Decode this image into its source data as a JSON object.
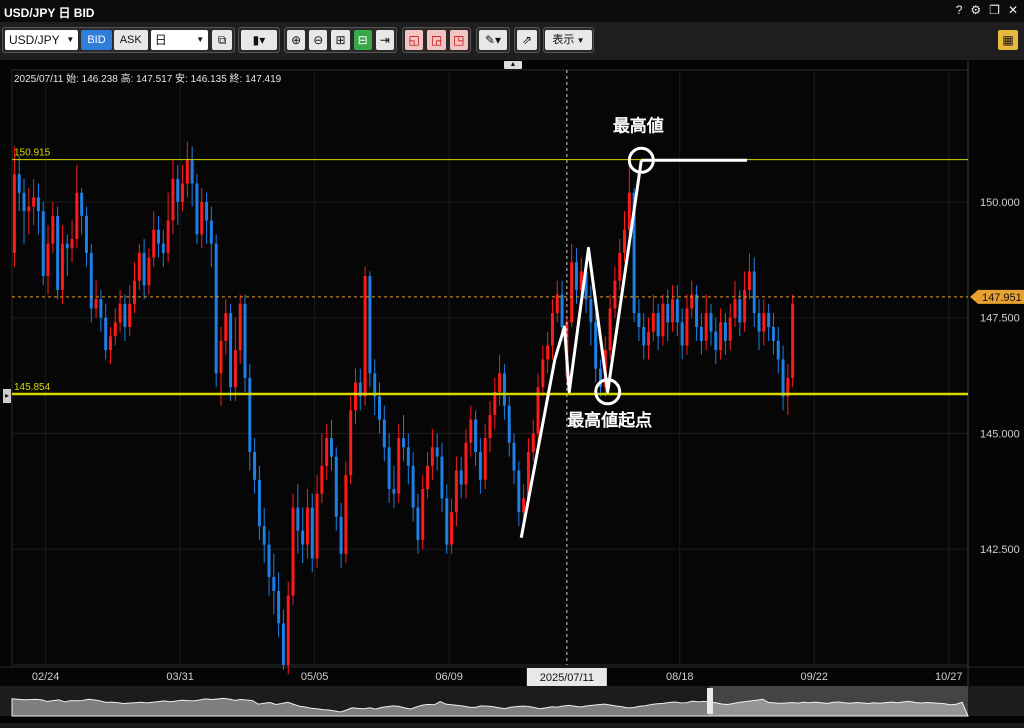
{
  "window": {
    "title": "USD/JPY 日 BID",
    "help_icon": "?",
    "controls": [
      "help-icon",
      "settings-gear-icon",
      "restore-window-icon",
      "close-icon"
    ]
  },
  "toolbar": {
    "symbol": "USD/JPY",
    "bid_label": "BID",
    "ask_label": "ASK",
    "period": "日",
    "display_label": "表示",
    "icons": [
      "compare-icon",
      "candle-type-icon",
      "zoom-in-icon",
      "zoom-out-icon",
      "fit-width-icon",
      "fit-height-icon",
      "scroll-right-icon",
      "draw-box-add-icon",
      "draw-box-copy-icon",
      "draw-box-delete-icon",
      "pen-icon",
      "export-icon",
      "layout-icon"
    ]
  },
  "info_bar": "2025/07/11  始: 146.238  高: 147.517  安: 146.135  終: 147.419",
  "colors": {
    "up": "#ff1a1a",
    "down": "#1e7fe6",
    "level_line": "#d8d800",
    "current_price": "#e8a030",
    "annotation": "#ffffff"
  },
  "chart_data": {
    "type": "candlestick",
    "y_ticks": [
      "150.000",
      "147.500",
      "145.000",
      "142.500"
    ],
    "y_tick_values": [
      150.0,
      147.5,
      145.0,
      142.5
    ],
    "ylim": [
      140.0,
      152.85
    ],
    "x_tick_labels": [
      "02/24",
      "03/31",
      "05/05",
      "06/09",
      "2025/07/11",
      "08/18",
      "09/22",
      "10/27"
    ],
    "x_tick_values": [
      7,
      35,
      63,
      91,
      115,
      139,
      167,
      195
    ],
    "x_range": [
      0,
      199
    ],
    "highlighted_date": "2025/07/11",
    "highlighted_index": 115,
    "horizontal_levels": [
      {
        "label": "150.915",
        "value": 150.915,
        "style": "thin"
      },
      {
        "label": "145.854",
        "value": 145.854,
        "style": "thick"
      }
    ],
    "current_price": {
      "label": "147.951",
      "value": 147.951
    },
    "annotations": {
      "high_label": "最高値",
      "start_label": "最高値起点",
      "high_point": {
        "x": 131,
        "y": 150.9
      },
      "start_point": {
        "x": 124,
        "y": 145.9
      }
    },
    "zigzag": [
      [
        106,
        142.75
      ],
      [
        113,
        146.6
      ],
      [
        115,
        147.3
      ],
      [
        116,
        145.9
      ],
      [
        120,
        149.0
      ],
      [
        124,
        145.9
      ],
      [
        131,
        150.9
      ]
    ],
    "high_flat_line": [
      [
        131,
        150.9
      ],
      [
        153,
        150.9
      ]
    ],
    "candles": [
      [
        148.9,
        150.6,
        151.2,
        148.6
      ],
      [
        150.6,
        150.2,
        151.0,
        149.8
      ],
      [
        150.2,
        149.8,
        150.5,
        149.1
      ],
      [
        149.8,
        149.9,
        150.3,
        149.3
      ],
      [
        149.9,
        150.1,
        150.5,
        149.5
      ],
      [
        150.1,
        149.8,
        150.4,
        149.3
      ],
      [
        149.8,
        148.4,
        150.0,
        148.2
      ],
      [
        148.4,
        149.1,
        149.5,
        148.0
      ],
      [
        149.1,
        149.7,
        150.0,
        148.9
      ],
      [
        149.7,
        148.1,
        149.9,
        147.9
      ],
      [
        148.1,
        149.1,
        149.5,
        147.8
      ],
      [
        149.1,
        149.0,
        149.3,
        148.4
      ],
      [
        149.0,
        149.2,
        149.6,
        148.7
      ],
      [
        149.2,
        150.2,
        150.8,
        149.0
      ],
      [
        150.2,
        149.7,
        150.3,
        149.3
      ],
      [
        149.7,
        148.9,
        149.9,
        148.6
      ],
      [
        148.9,
        147.7,
        149.1,
        147.4
      ],
      [
        147.7,
        147.9,
        148.3,
        147.5
      ],
      [
        147.9,
        147.5,
        148.1,
        147.2
      ],
      [
        147.5,
        146.8,
        147.8,
        146.6
      ],
      [
        146.8,
        147.1,
        147.3,
        146.5
      ],
      [
        147.1,
        147.4,
        147.7,
        146.9
      ],
      [
        147.4,
        147.8,
        148.1,
        147.2
      ],
      [
        147.8,
        147.3,
        148.0,
        147.0
      ],
      [
        147.3,
        147.8,
        148.2,
        147.1
      ],
      [
        147.8,
        148.3,
        148.7,
        147.6
      ],
      [
        148.3,
        148.9,
        149.1,
        148.1
      ],
      [
        148.9,
        148.2,
        149.2,
        147.9
      ],
      [
        148.2,
        148.8,
        149.0,
        148.0
      ],
      [
        148.8,
        149.4,
        149.8,
        148.6
      ],
      [
        149.4,
        149.1,
        149.7,
        148.8
      ],
      [
        149.1,
        148.9,
        149.4,
        148.6
      ],
      [
        148.9,
        149.6,
        150.2,
        148.7
      ],
      [
        149.6,
        150.5,
        150.9,
        149.3
      ],
      [
        150.5,
        150.0,
        150.8,
        149.5
      ],
      [
        150.0,
        150.4,
        150.8,
        149.8
      ],
      [
        150.4,
        150.9,
        151.3,
        150.1
      ],
      [
        150.9,
        150.4,
        151.2,
        149.9
      ],
      [
        150.4,
        149.3,
        150.6,
        149.1
      ],
      [
        149.3,
        150.0,
        150.3,
        149.0
      ],
      [
        150.0,
        149.6,
        150.2,
        149.1
      ],
      [
        149.6,
        149.1,
        149.9,
        148.6
      ],
      [
        149.1,
        146.3,
        149.3,
        146.0
      ],
      [
        146.3,
        147.0,
        147.3,
        145.6
      ],
      [
        147.0,
        147.6,
        147.9,
        146.7
      ],
      [
        147.6,
        146.0,
        147.8,
        145.7
      ],
      [
        146.0,
        146.8,
        147.5,
        145.7
      ],
      [
        146.8,
        147.8,
        148.0,
        146.5
      ],
      [
        147.8,
        146.2,
        148.0,
        145.9
      ],
      [
        146.2,
        144.6,
        146.5,
        144.2
      ],
      [
        144.6,
        144.0,
        144.9,
        143.7
      ],
      [
        144.0,
        143.0,
        144.3,
        142.7
      ],
      [
        143.0,
        142.6,
        143.4,
        142.2
      ],
      [
        142.6,
        141.9,
        142.9,
        141.5
      ],
      [
        141.9,
        141.6,
        142.4,
        141.1
      ],
      [
        141.6,
        140.9,
        142.0,
        140.6
      ],
      [
        140.9,
        140.0,
        141.2,
        139.9
      ],
      [
        140.0,
        141.5,
        141.8,
        139.8
      ],
      [
        141.5,
        143.4,
        143.7,
        141.3
      ],
      [
        143.4,
        142.9,
        143.9,
        142.4
      ],
      [
        142.9,
        142.6,
        143.4,
        142.2
      ],
      [
        142.6,
        143.4,
        143.8,
        142.3
      ],
      [
        143.4,
        142.3,
        143.7,
        142.0
      ],
      [
        142.3,
        143.7,
        144.1,
        142.1
      ],
      [
        143.7,
        144.3,
        145.0,
        143.5
      ],
      [
        144.3,
        144.9,
        145.2,
        144.0
      ],
      [
        144.9,
        144.5,
        145.3,
        144.2
      ],
      [
        144.5,
        143.2,
        144.7,
        142.9
      ],
      [
        143.2,
        142.4,
        143.5,
        142.1
      ],
      [
        142.4,
        144.1,
        144.4,
        142.2
      ],
      [
        144.1,
        145.5,
        145.8,
        143.9
      ],
      [
        145.5,
        146.1,
        146.4,
        145.2
      ],
      [
        146.1,
        145.8,
        146.4,
        145.5
      ],
      [
        145.8,
        148.4,
        148.6,
        145.6
      ],
      [
        148.4,
        146.3,
        148.5,
        146.0
      ],
      [
        146.3,
        145.8,
        146.6,
        145.4
      ],
      [
        145.8,
        145.3,
        146.1,
        145.0
      ],
      [
        145.3,
        144.7,
        145.6,
        144.4
      ],
      [
        144.7,
        143.8,
        145.0,
        143.5
      ],
      [
        143.8,
        143.7,
        144.3,
        143.4
      ],
      [
        143.7,
        144.9,
        145.2,
        143.5
      ],
      [
        144.9,
        144.7,
        145.4,
        144.4
      ],
      [
        144.7,
        144.3,
        145.0,
        143.9
      ],
      [
        144.3,
        143.4,
        144.6,
        143.1
      ],
      [
        143.4,
        142.7,
        143.7,
        142.4
      ],
      [
        142.7,
        143.8,
        144.1,
        142.5
      ],
      [
        143.8,
        144.3,
        144.6,
        143.6
      ],
      [
        144.3,
        144.7,
        145.1,
        144.0
      ],
      [
        144.7,
        144.5,
        145.0,
        144.2
      ],
      [
        144.5,
        143.6,
        144.8,
        143.3
      ],
      [
        143.6,
        142.6,
        143.9,
        142.4
      ],
      [
        142.6,
        143.3,
        143.6,
        142.4
      ],
      [
        143.3,
        144.2,
        144.5,
        143.0
      ],
      [
        144.2,
        143.9,
        144.5,
        143.6
      ],
      [
        143.9,
        144.8,
        145.1,
        143.6
      ],
      [
        144.8,
        145.3,
        145.6,
        144.5
      ],
      [
        145.3,
        144.6,
        145.5,
        144.3
      ],
      [
        144.6,
        144.0,
        144.9,
        143.7
      ],
      [
        144.0,
        144.9,
        145.2,
        143.8
      ],
      [
        144.9,
        145.4,
        145.7,
        144.6
      ],
      [
        145.4,
        145.9,
        146.2,
        145.1
      ],
      [
        145.9,
        146.3,
        146.7,
        145.6
      ],
      [
        146.3,
        145.6,
        146.5,
        145.3
      ],
      [
        145.6,
        144.8,
        145.8,
        144.5
      ],
      [
        144.8,
        144.2,
        145.0,
        143.9
      ],
      [
        144.2,
        143.3,
        144.4,
        143.0
      ],
      [
        143.3,
        143.6,
        143.9,
        142.9
      ],
      [
        143.6,
        144.6,
        144.9,
        143.4
      ],
      [
        144.6,
        145.0,
        145.3,
        144.4
      ],
      [
        145.0,
        146.0,
        146.3,
        144.8
      ],
      [
        146.0,
        146.6,
        146.9,
        145.8
      ],
      [
        146.6,
        146.9,
        147.2,
        146.3
      ],
      [
        146.9,
        147.6,
        147.9,
        146.6
      ],
      [
        147.6,
        148.0,
        148.3,
        147.4
      ],
      [
        148.0,
        147.3,
        148.3,
        147.0
      ],
      [
        146.238,
        147.419,
        147.517,
        146.135
      ],
      [
        147.4,
        148.7,
        149.1,
        147.3
      ],
      [
        148.7,
        148.1,
        149.0,
        147.8
      ],
      [
        148.1,
        148.5,
        148.8,
        147.7
      ],
      [
        148.5,
        147.9,
        148.7,
        147.6
      ],
      [
        147.9,
        147.4,
        148.2,
        146.9
      ],
      [
        147.4,
        146.4,
        147.6,
        146.1
      ],
      [
        146.4,
        146.0,
        146.6,
        145.8
      ],
      [
        146.0,
        146.8,
        147.1,
        145.8
      ],
      [
        146.8,
        147.7,
        148.0,
        146.6
      ],
      [
        147.7,
        148.3,
        148.6,
        147.5
      ],
      [
        148.3,
        148.9,
        149.2,
        148.1
      ],
      [
        148.9,
        149.4,
        149.8,
        148.7
      ],
      [
        149.4,
        150.2,
        150.9,
        149.2
      ],
      [
        150.2,
        147.6,
        150.3,
        147.4
      ],
      [
        147.6,
        147.3,
        147.9,
        147.0
      ],
      [
        147.3,
        146.9,
        147.6,
        146.6
      ],
      [
        146.9,
        147.2,
        147.5,
        146.6
      ],
      [
        147.2,
        147.6,
        148.0,
        147.0
      ],
      [
        147.6,
        147.1,
        147.8,
        146.8
      ],
      [
        147.1,
        147.8,
        148.0,
        146.9
      ],
      [
        147.8,
        147.4,
        148.1,
        147.0
      ],
      [
        147.4,
        147.9,
        148.2,
        147.2
      ],
      [
        147.9,
        147.4,
        148.2,
        147.1
      ],
      [
        147.4,
        146.9,
        147.7,
        146.6
      ],
      [
        146.9,
        147.7,
        148.0,
        146.7
      ],
      [
        147.7,
        148.0,
        148.3,
        147.5
      ],
      [
        148.0,
        147.3,
        148.2,
        147.0
      ],
      [
        147.3,
        147.0,
        147.6,
        146.7
      ],
      [
        147.0,
        147.6,
        148.0,
        146.8
      ],
      [
        147.6,
        147.2,
        147.8,
        146.9
      ],
      [
        147.2,
        146.8,
        147.5,
        146.5
      ],
      [
        146.8,
        147.4,
        147.7,
        146.6
      ],
      [
        147.4,
        147.0,
        147.6,
        146.7
      ],
      [
        147.0,
        147.5,
        147.8,
        146.8
      ],
      [
        147.5,
        147.9,
        148.3,
        147.3
      ],
      [
        147.9,
        147.4,
        148.1,
        147.1
      ],
      [
        147.4,
        148.1,
        148.5,
        147.2
      ],
      [
        148.1,
        148.5,
        148.9,
        147.9
      ],
      [
        148.5,
        147.6,
        148.8,
        147.3
      ],
      [
        147.6,
        147.2,
        147.9,
        146.8
      ],
      [
        147.2,
        147.6,
        147.9,
        146.9
      ],
      [
        147.6,
        147.3,
        147.8,
        147.0
      ],
      [
        147.3,
        147.0,
        147.6,
        146.7
      ],
      [
        147.0,
        146.6,
        147.3,
        146.3
      ],
      [
        146.6,
        145.8,
        146.9,
        145.5
      ],
      [
        145.8,
        146.2,
        146.5,
        145.4
      ],
      [
        146.2,
        147.8,
        148.0,
        146.0
      ]
    ],
    "navigator": true
  }
}
